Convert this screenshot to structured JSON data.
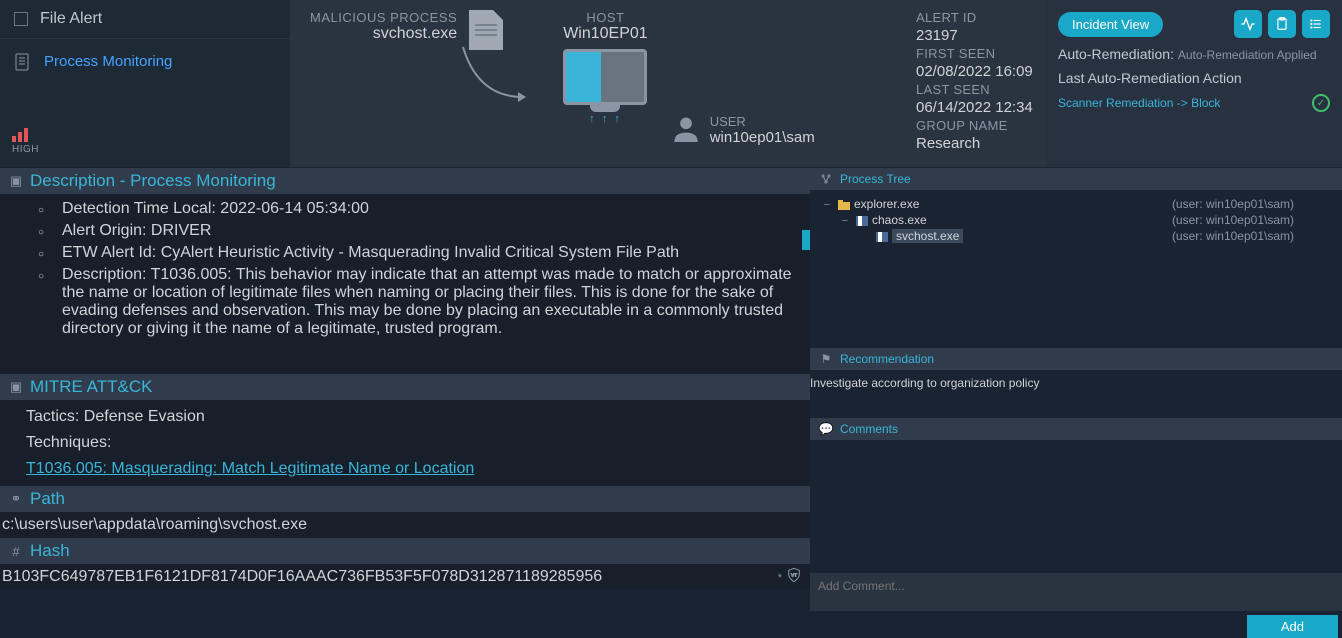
{
  "header": {
    "title": "File Alert",
    "process_monitoring": "Process Monitoring",
    "severity": "HIGH",
    "malicious_process_label": "MALICIOUS PROCESS",
    "malicious_process": "svchost.exe",
    "host_label": "HOST",
    "host": "Win10EP01",
    "user_label": "USER",
    "user": "win10ep01\\sam",
    "arrows": "↑ ↑ ↑"
  },
  "info": {
    "alert_id_label": "ALERT ID",
    "alert_id": "23197",
    "first_seen_label": "FIRST SEEN",
    "first_seen": "02/08/2022 16:09",
    "last_seen_label": "LAST SEEN",
    "last_seen": "06/14/2022 12:34",
    "group_label": "GROUP NAME",
    "group": "Research"
  },
  "actions": {
    "incident_view": "Incident View",
    "auto_rem_label": "Auto-Remediation:",
    "auto_rem_val": "Auto-Remediation Applied",
    "last_action_label": "Last Auto-Remediation Action",
    "action_link": "Scanner Remediation -> Block"
  },
  "description": {
    "title": "Description - Process Monitoring",
    "items": [
      "Detection Time Local: 2022-06-14 05:34:00",
      "Alert Origin: DRIVER",
      "ETW Alert Id: CyAlert Heuristic Activity - Masquerading Invalid Critical System File Path",
      "Description: T1036.005: This behavior may indicate that an attempt was made to match or approximate the name or location of legitimate files when naming or placing their files. This is done for the sake of evading defenses and observation. This may be done by placing an executable in a commonly trusted directory or giving it the name of a legitimate, trusted program."
    ]
  },
  "mitre": {
    "title": "MITRE ATT&CK",
    "tactics": "Tactics: Defense Evasion",
    "techniques_label": "Techniques:",
    "technique_link": "T1036.005: Masquerading: Match Legitimate Name or Location"
  },
  "path": {
    "title": "Path",
    "value": "c:\\users\\user\\appdata\\roaming\\svchost.exe"
  },
  "hash": {
    "title": "Hash",
    "value": "B103FC649787EB1F6121DF8174D0F16AAAC736FB53F5F078D312871189285956"
  },
  "process_tree": {
    "title": "Process Tree",
    "rows": [
      {
        "indent": 0,
        "exp": "–",
        "icon": "folder",
        "name": "explorer.exe",
        "user": "(user: win10ep01\\sam)"
      },
      {
        "indent": 1,
        "exp": "–",
        "icon": "flag",
        "name": "chaos.exe",
        "user": "(user: win10ep01\\sam)"
      },
      {
        "indent": 2,
        "exp": "",
        "icon": "flag",
        "name": "svchost.exe",
        "user": "(user: win10ep01\\sam)",
        "selected": true
      }
    ]
  },
  "recommendation": {
    "title": "Recommendation",
    "text": "Investigate according to organization policy"
  },
  "comments": {
    "title": "Comments",
    "placeholder": "Add Comment...",
    "add": "Add"
  }
}
